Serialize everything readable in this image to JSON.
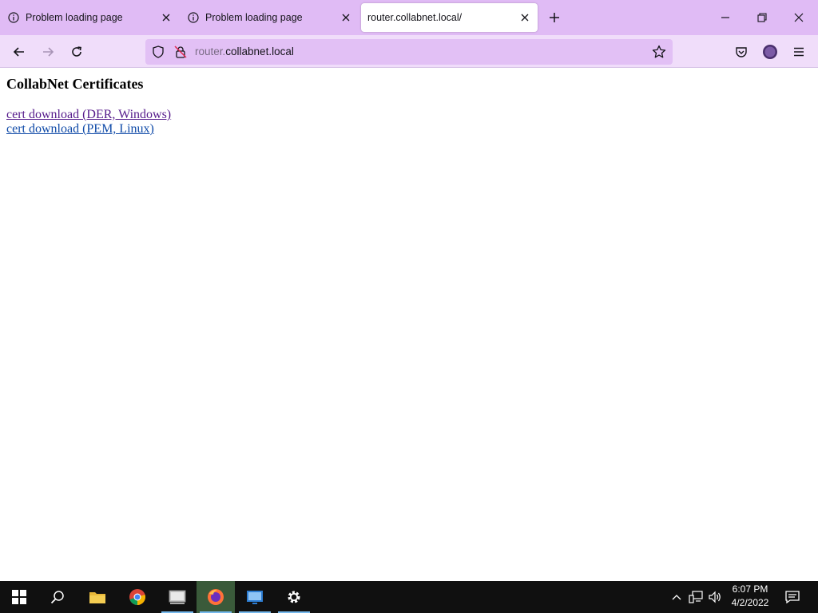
{
  "tabs": [
    {
      "title": "Problem loading page",
      "icon": "info-icon"
    },
    {
      "title": "Problem loading page",
      "icon": "info-icon"
    },
    {
      "title": "router.collabnet.local/",
      "icon": ""
    }
  ],
  "urlbar": {
    "host_prefix": "router.",
    "host_main": "collabnet.local"
  },
  "page": {
    "heading": "CollabNet Certificates",
    "links": [
      {
        "label": "cert download (DER, Windows)"
      },
      {
        "label": "cert download (PEM, Linux)"
      }
    ]
  },
  "taskbar": {
    "apps": [
      "windows-start-icon",
      "search-icon",
      "file-explorer-icon",
      "chrome-icon",
      "network-app-icon",
      "firefox-icon",
      "remote-desktop-icon",
      "settings-icon"
    ],
    "clock_time": "6:07 PM",
    "clock_date": "4/2/2022"
  },
  "colors": {
    "tabbar": "#e0bbf5",
    "navbar": "#f0ddfa",
    "urlbar": "#e2c0f5",
    "taskbar": "#101010"
  }
}
